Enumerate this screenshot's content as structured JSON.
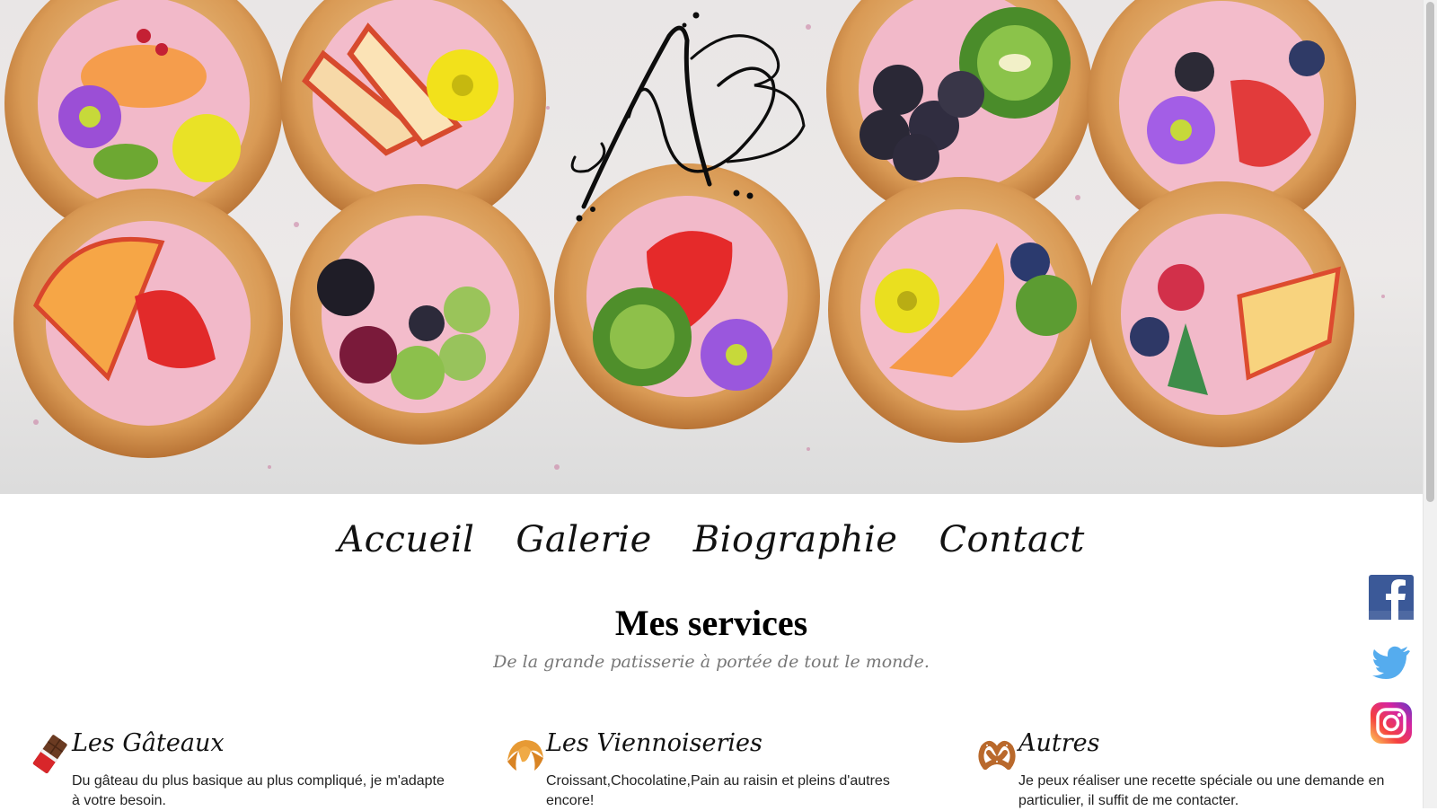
{
  "hero": {
    "logo": "NB",
    "logo_icon": "nb-monogram-logo",
    "image": "pastry-tartlets-with-fruit-and-flowers"
  },
  "nav": {
    "items": [
      {
        "label": "Accueil"
      },
      {
        "label": "Galerie"
      },
      {
        "label": "Biographie"
      },
      {
        "label": "Contact"
      }
    ]
  },
  "services": {
    "title": "Mes services",
    "subtitle": "De la grande patisserie à portée de tout le monde.",
    "items": [
      {
        "icon": "chocolate-bar-icon",
        "title": "Les Gâteaux",
        "text": "Du gâteau du plus basique au plus compliqué, je m'adapte à votre besoin."
      },
      {
        "icon": "croissant-icon",
        "title": "Les Viennoiseries",
        "text": "Croissant,Chocolatine,Pain au raisin et pleins d'autres encore!"
      },
      {
        "icon": "pretzel-icon",
        "title": "Autres",
        "text": "Je peux réaliser une recette spéciale ou une demande en particulier, il suffit de me contacter."
      }
    ]
  },
  "social": [
    {
      "icon": "facebook-icon",
      "color": "#3b5998"
    },
    {
      "icon": "twitter-icon",
      "color": "#55acee"
    },
    {
      "icon": "instagram-icon",
      "color": "#d6249f"
    }
  ]
}
